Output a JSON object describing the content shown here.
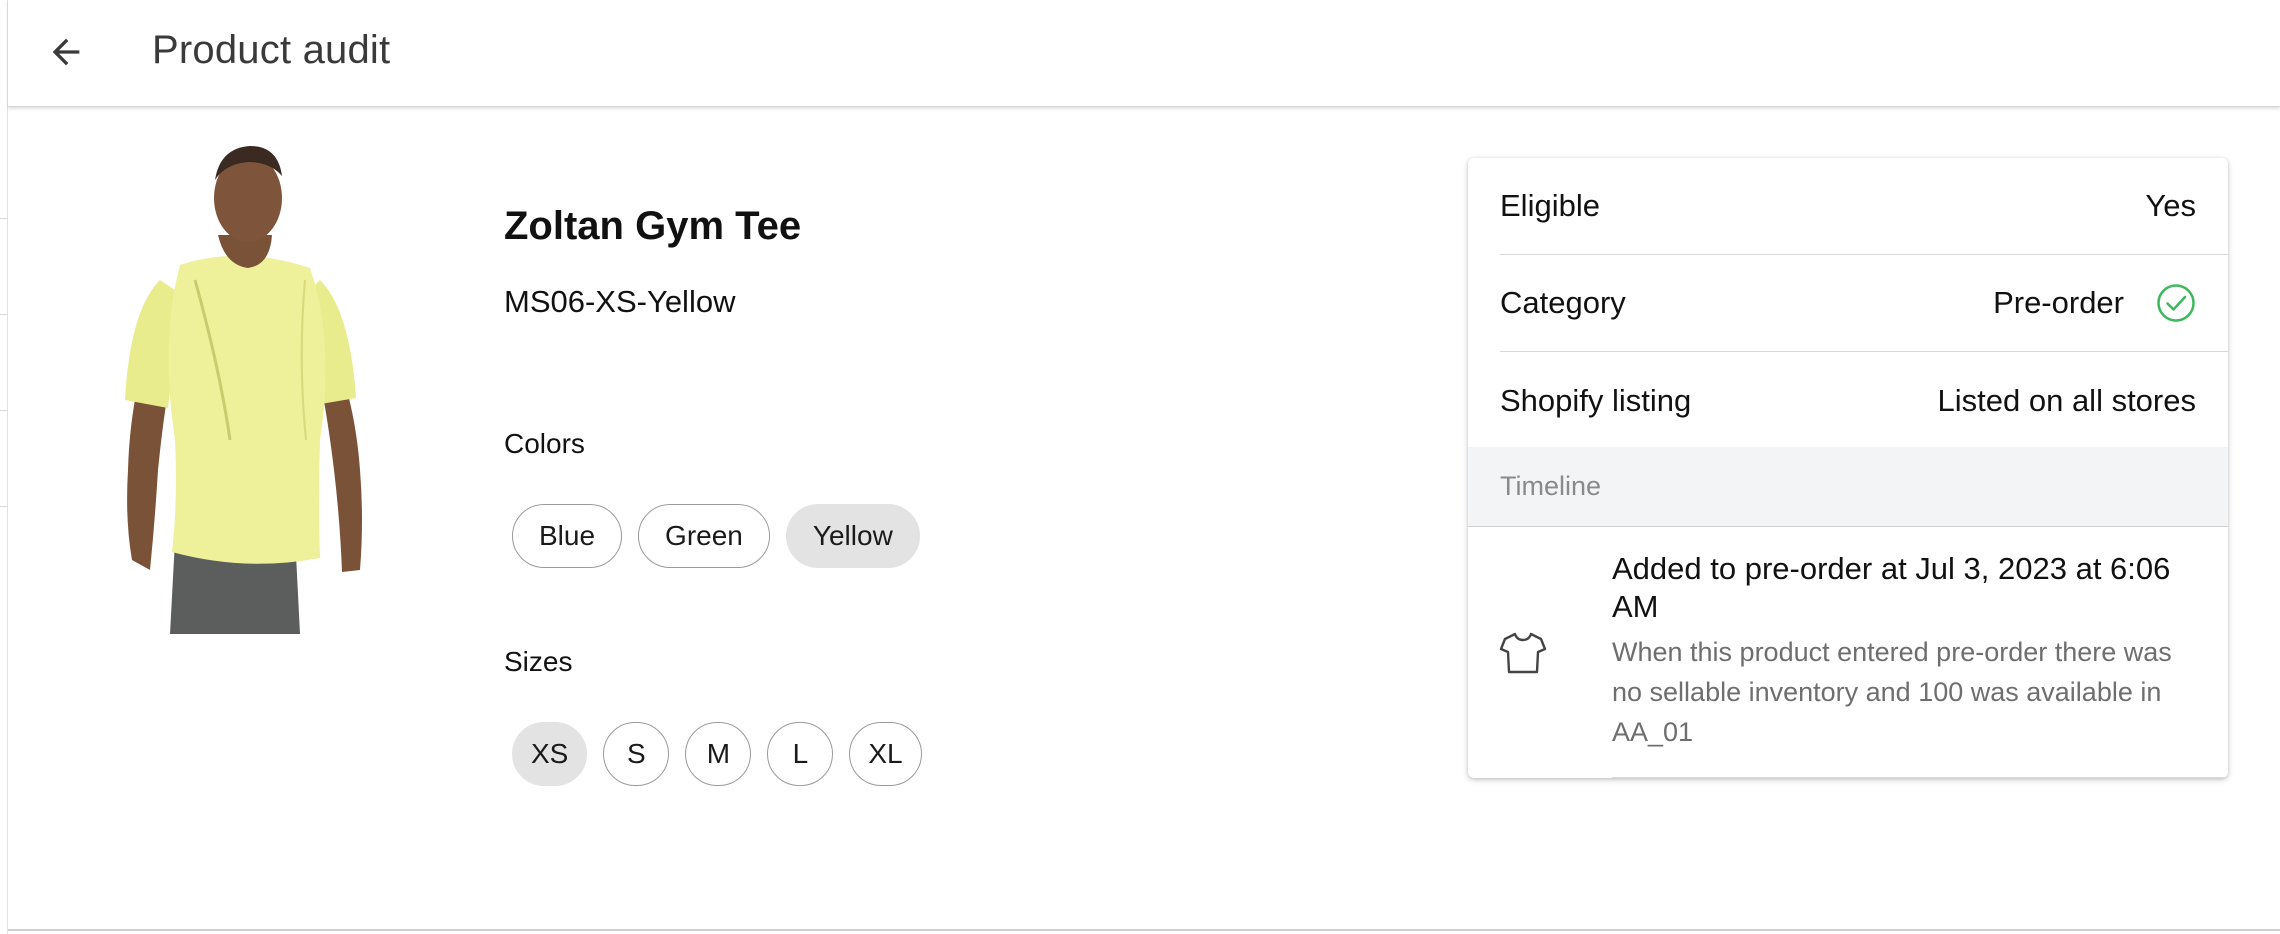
{
  "header": {
    "title": "Product audit",
    "back_icon": "arrow-left-icon"
  },
  "product": {
    "name": "Zoltan Gym Tee",
    "sku": "MS06-XS-Yellow",
    "image_icon": "product-photo-tee-yellow",
    "colors_label": "Colors",
    "colors": [
      {
        "label": "Blue",
        "selected": false
      },
      {
        "label": "Green",
        "selected": false
      },
      {
        "label": "Yellow",
        "selected": true
      }
    ],
    "sizes_label": "Sizes",
    "sizes": [
      {
        "label": "XS",
        "selected": true
      },
      {
        "label": "S",
        "selected": false
      },
      {
        "label": "M",
        "selected": false
      },
      {
        "label": "L",
        "selected": false
      },
      {
        "label": "XL",
        "selected": false
      }
    ]
  },
  "audit_card": {
    "eligible": {
      "label": "Eligible",
      "value": "Yes"
    },
    "category": {
      "label": "Category",
      "value": "Pre-order",
      "status_icon": "check-circle-icon",
      "status_color": "#3cb85e"
    },
    "shopify": {
      "label": "Shopify listing",
      "value": "Listed on all stores"
    },
    "timeline_label": "Timeline",
    "timeline": [
      {
        "icon": "tshirt-icon",
        "title": "Added to pre-order at Jul 3, 2023 at 6:06 AM",
        "description": "When this product entered pre-order there was no sellable inventory and 100 was available in AA_01"
      }
    ]
  }
}
